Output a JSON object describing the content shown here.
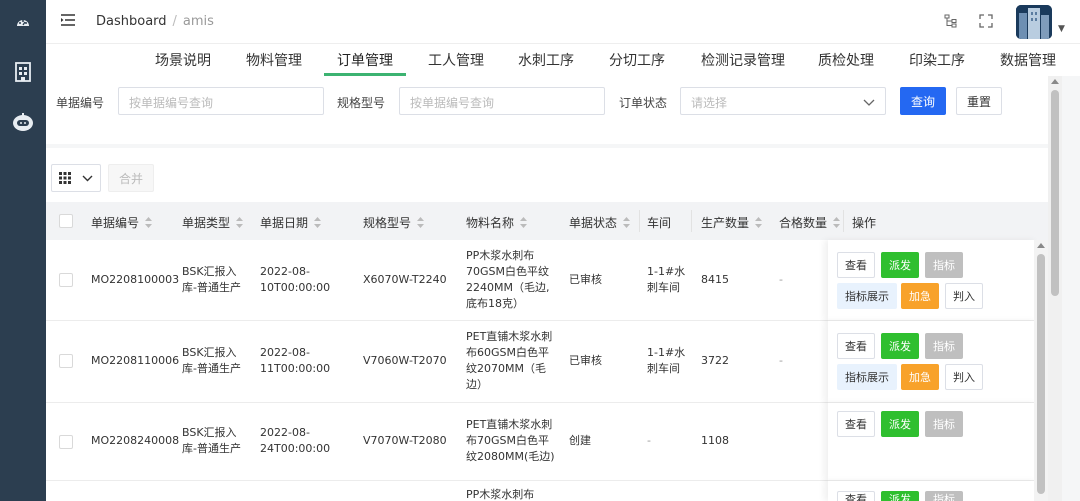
{
  "header": {
    "breadcrumb": [
      "Dashboard",
      "amis"
    ]
  },
  "tabs": [
    "场景说明",
    "物料管理",
    "订单管理",
    "工人管理",
    "水刺工序",
    "分切工序",
    "检测记录管理",
    "质检处理",
    "印染工序",
    "数据管理"
  ],
  "active_tab": "订单管理",
  "filter": {
    "field1_label": "单据编号",
    "field1_placeholder": "按单据编号查询",
    "field2_label": "规格型号",
    "field2_placeholder": "按单据编号查询",
    "field3_label": "订单状态",
    "field3_placeholder": "请选择",
    "query_label": "查询",
    "reset_label": "重置"
  },
  "toolbar": {
    "merge_label": "合并"
  },
  "table": {
    "columns": [
      "单据编号",
      "单据类型",
      "单据日期",
      "规格型号",
      "物料名称",
      "单据状态",
      "车间",
      "生产数量",
      "合格数量",
      "操作"
    ],
    "rows": [
      {
        "id": "MO2208100003",
        "type": [
          "BSK汇报入",
          "库-普通生产"
        ],
        "date": [
          "2022-08-",
          "10T00:00:00"
        ],
        "spec": "X6070W-T2240",
        "material": [
          "PP木浆水刺布",
          "70GSM白色平纹",
          "2240MM（毛边,",
          "底布18克）"
        ],
        "status": "已审核",
        "workshop": [
          "1-1#水",
          "刺车间"
        ],
        "qty": "8415",
        "passed": "-"
      },
      {
        "id": "MO2208110006",
        "type": [
          "BSK汇报入",
          "库-普通生产"
        ],
        "date": [
          "2022-08-",
          "11T00:00:00"
        ],
        "spec": "V7060W-T2070",
        "material": [
          "PET直铺木浆水刺",
          "布60GSM白色平",
          "纹2070MM（毛",
          "边）"
        ],
        "status": "已审核",
        "workshop": [
          "1-1#水",
          "刺车间"
        ],
        "qty": "3722",
        "passed": "-"
      },
      {
        "id": "MO2208240008",
        "type": [
          "BSK汇报入",
          "库-普通生产"
        ],
        "date": [
          "2022-08-",
          "24T00:00:00"
        ],
        "spec": "V7070W-T2080",
        "material": [
          "PET直铺木浆水刺",
          "布70GSM白色平",
          "纹2080MM(毛边)"
        ],
        "status": "创建",
        "workshop": [
          "-"
        ],
        "qty": "1108",
        "passed": ""
      },
      {
        "material": [
          "PP木浆水刺布"
        ]
      }
    ],
    "ops": {
      "view": "查看",
      "dispatch": "派发",
      "index": "指标",
      "show_index": "指标展示",
      "urgent": "加急",
      "judge": "判入"
    }
  }
}
